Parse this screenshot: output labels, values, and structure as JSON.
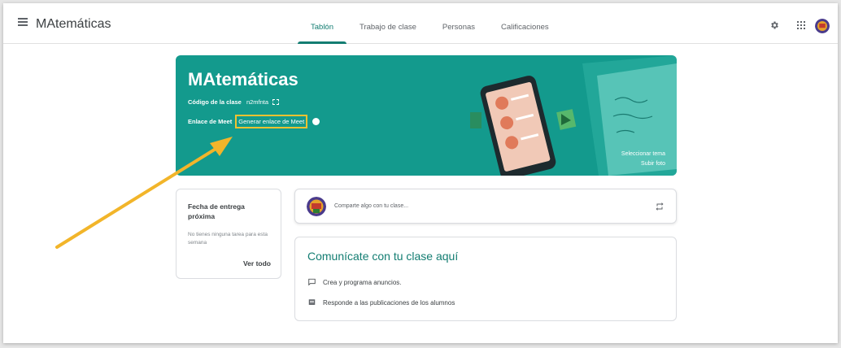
{
  "header": {
    "app_title": "MAtemáticas",
    "tabs": [
      {
        "label": "Tablón",
        "active": true
      },
      {
        "label": "Trabajo de clase",
        "active": false
      },
      {
        "label": "Personas",
        "active": false
      },
      {
        "label": "Calificaciones",
        "active": false
      }
    ],
    "icons": [
      "menu-icon",
      "gear-icon",
      "apps-grid-icon",
      "user-avatar"
    ]
  },
  "banner": {
    "title": "MAtemáticas",
    "class_code_label": "Código de la clase",
    "class_code": "n2mfnta",
    "meet_label": "Enlace de Meet",
    "meet_link": "Generar enlace de Meet",
    "select_theme": "Seleccionar tema",
    "upload_photo": "Subir foto",
    "color": "#139a8d",
    "highlight_color": "#f2c230"
  },
  "upcoming": {
    "title": "Fecha de entrega próxima",
    "empty": "No tienes ninguna tarea para esta semana",
    "view_all": "Ver todo"
  },
  "share": {
    "placeholder": "Comparte algo con tu clase..."
  },
  "communicate": {
    "title": "Comunícate con tu clase aquí",
    "items": [
      {
        "icon": "comment-icon",
        "label": "Crea y programa anuncios."
      },
      {
        "icon": "reply-icon",
        "label": "Responde a las publicaciones de los alumnos"
      }
    ]
  },
  "colors": {
    "accent": "#137d72",
    "arrow": "#f2b52a"
  }
}
